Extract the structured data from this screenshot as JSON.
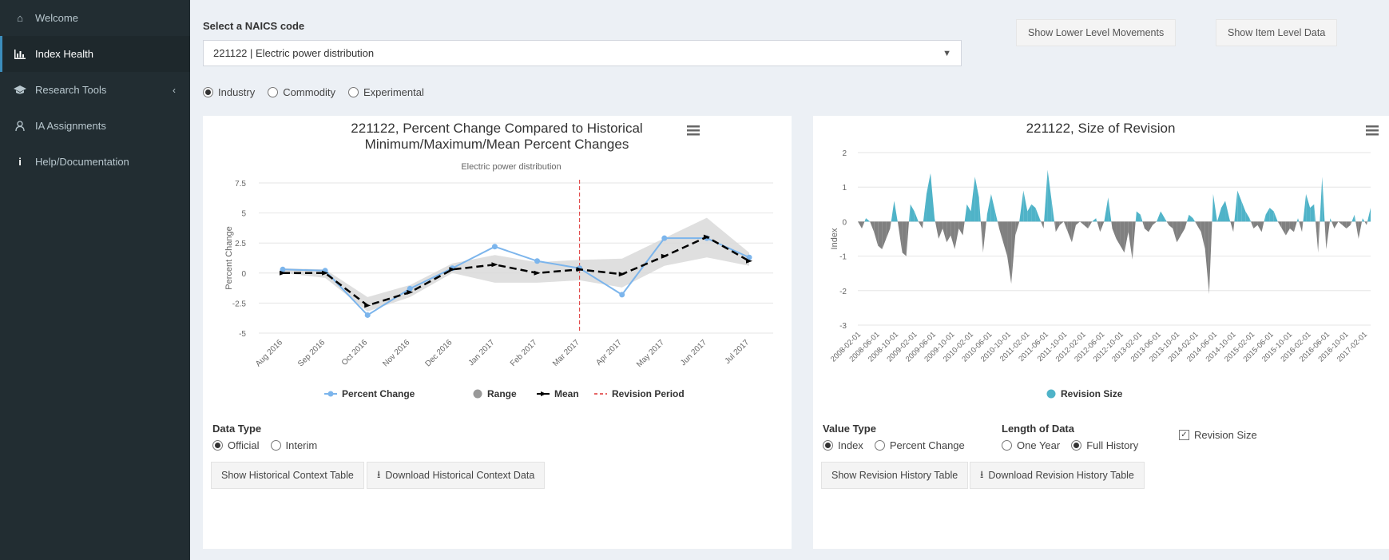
{
  "sidebar": {
    "items": [
      {
        "label": "Welcome",
        "icon": "home-icon"
      },
      {
        "label": "Index Health",
        "icon": "bar-chart-icon"
      },
      {
        "label": "Research Tools",
        "icon": "graduation-cap-icon"
      },
      {
        "label": "IA Assignments",
        "icon": "user-icon"
      },
      {
        "label": "Help/Documentation",
        "icon": "info-icon"
      }
    ]
  },
  "naics": {
    "label": "Select a NAICS code",
    "value": "221122 | Electric power distribution"
  },
  "buttons": {
    "lower_level": "Show Lower Level Movements",
    "item_level": "Show Item Level Data",
    "hist_table": "Show Historical Context Table",
    "hist_download": "Download Historical Context Data",
    "rev_table": "Show Revision History Table",
    "rev_download": "Download Revision History Table"
  },
  "type_radio": {
    "options": [
      "Industry",
      "Commodity",
      "Experimental"
    ],
    "selected": "Industry"
  },
  "left_controls": {
    "label": "Data Type",
    "options": [
      "Official",
      "Interim"
    ],
    "selected": "Official"
  },
  "right_controls": {
    "value_type_label": "Value Type",
    "value_type_options": [
      "Index",
      "Percent Change"
    ],
    "value_type_selected": "Index",
    "length_label": "Length of Data",
    "length_options": [
      "One Year",
      "Full History"
    ],
    "length_selected": "Full History",
    "checkbox_label": "Revision Size",
    "checkbox_checked": true
  },
  "colors": {
    "accent": "#3c8dbc",
    "percent_change": "#7cb5ec",
    "range": "#d9d9d9",
    "revision_pos": "#4fb3c8",
    "revision_neg": "#808080",
    "revision_line": "#dd3333"
  },
  "chart_data": [
    {
      "type": "line",
      "title": "221122, Percent Change Compared to Historical Minimum/Maximum/Mean Percent Changes",
      "subtitle": "Electric power distribution",
      "ylabel": "Percent Change",
      "ylim": [
        -5,
        7.5
      ],
      "yticks": [
        "7.5",
        "5",
        "2.5",
        "0",
        "-2.5",
        "-5"
      ],
      "categories": [
        "Aug 2016",
        "Sep 2016",
        "Oct 2016",
        "Nov 2016",
        "Dec 2016",
        "Jan 2017",
        "Feb 2017",
        "Mar 2017",
        "Apr 2017",
        "May 2017",
        "Jun 2017",
        "Jul 2017"
      ],
      "series": [
        {
          "name": "Percent Change",
          "values": [
            0.3,
            0.2,
            -3.5,
            -1.3,
            0.4,
            2.2,
            1.0,
            0.4,
            -1.8,
            2.9,
            2.9,
            1.3
          ]
        },
        {
          "name": "Range",
          "low": [
            0.0,
            -0.4,
            -3.2,
            -2.0,
            0.0,
            -0.8,
            -0.8,
            -0.6,
            -1.2,
            0.6,
            1.3,
            0.6
          ],
          "high": [
            0.4,
            0.3,
            -2.0,
            -1.0,
            0.8,
            1.5,
            0.9,
            1.1,
            1.2,
            2.9,
            4.6,
            1.7
          ]
        },
        {
          "name": "Mean",
          "values": [
            0.0,
            0.0,
            -2.7,
            -1.6,
            0.3,
            0.7,
            0.0,
            0.3,
            -0.1,
            1.4,
            3.0,
            1.0
          ]
        },
        {
          "name": "Revision Period",
          "at_category": "Mar 2017"
        }
      ],
      "legend": [
        "Percent Change",
        "Range",
        "Mean",
        "Revision Period"
      ],
      "legend_position": "bottom",
      "grid": true
    },
    {
      "type": "area",
      "title": "221122, Size of Revision",
      "ylabel": "Index",
      "ylim": [
        -3,
        2
      ],
      "yticks": [
        "2",
        "1",
        "0",
        "-1",
        "-2",
        "-3"
      ],
      "x_tick_labels": [
        "2008-02-01",
        "2008-06-01",
        "2008-10-01",
        "2009-02-01",
        "2009-06-01",
        "2009-10-01",
        "2010-02-01",
        "2010-06-01",
        "2010-10-01",
        "2011-02-01",
        "2011-06-01",
        "2011-10-01",
        "2012-02-01",
        "2012-06-01",
        "2012-10-01",
        "2013-02-01",
        "2013-06-01",
        "2013-10-01",
        "2014-02-01",
        "2014-06-01",
        "2014-10-01",
        "2015-02-01",
        "2015-06-01",
        "2015-10-01",
        "2016-02-01",
        "2016-06-01",
        "2016-10-01",
        "2017-02-01"
      ],
      "series": [
        {
          "name": "Revision Size",
          "values": [
            0.0,
            -0.2,
            0.1,
            0.0,
            -0.3,
            -0.7,
            -0.8,
            -0.5,
            -0.2,
            0.6,
            -0.1,
            -0.9,
            -1.0,
            0.5,
            0.3,
            0.0,
            -0.2,
            0.8,
            1.4,
            0.1,
            -0.5,
            -0.2,
            -0.6,
            -0.4,
            -0.8,
            -0.2,
            -0.4,
            0.5,
            0.3,
            1.3,
            0.7,
            -0.9,
            0.2,
            0.8,
            0.3,
            -0.2,
            -0.6,
            -1.0,
            -1.8,
            -0.4,
            0.0,
            0.9,
            0.3,
            0.5,
            0.4,
            0.1,
            -0.2,
            1.5,
            0.6,
            -0.3,
            -0.1,
            0.0,
            -0.3,
            -0.6,
            -0.1,
            0.0,
            -0.1,
            -0.2,
            0.0,
            0.1,
            -0.3,
            0.0,
            0.7,
            -0.2,
            -0.5,
            -0.7,
            -0.9,
            -0.3,
            -1.1,
            0.3,
            0.2,
            -0.2,
            -0.3,
            -0.1,
            0.0,
            0.3,
            0.1,
            -0.1,
            -0.2,
            -0.6,
            -0.4,
            -0.2,
            0.2,
            0.1,
            -0.1,
            -0.3,
            -0.8,
            -2.1,
            0.8,
            0.0,
            0.4,
            0.6,
            0.1,
            -0.3,
            0.9,
            0.6,
            0.3,
            0.1,
            -0.2,
            -0.1,
            -0.3,
            0.2,
            0.4,
            0.3,
            0.0,
            -0.2,
            -0.4,
            -0.2,
            -0.3,
            0.1,
            -0.3,
            0.8,
            0.4,
            0.5,
            -0.9,
            1.3,
            -0.8,
            0.1,
            -0.2,
            0.0,
            -0.1,
            -0.2,
            -0.1,
            0.2,
            -0.5,
            0.1,
            -0.1,
            0.4
          ]
        }
      ],
      "legend": [
        "Revision Size"
      ],
      "legend_position": "bottom",
      "grid": true
    }
  ]
}
